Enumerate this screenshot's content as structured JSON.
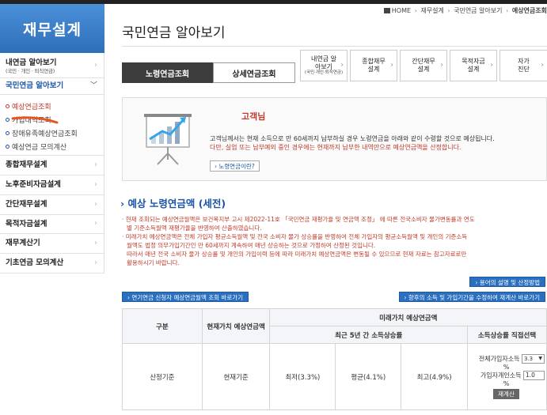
{
  "sidebar": {
    "title": "재무설계",
    "items": [
      {
        "label": "내연금 알아보기",
        "sub": "(국민 · 개인 · 퇴직연금)"
      },
      {
        "label": "국민연금 알아보기"
      },
      {
        "label": "종합재무설계"
      },
      {
        "label": "노후준비자금설계"
      },
      {
        "label": "간단재무설계"
      },
      {
        "label": "목적자금설계"
      },
      {
        "label": "재무계산기"
      },
      {
        "label": "기초연금 모의계산"
      }
    ],
    "subitems": [
      "예상연금조회",
      "가입내역조회",
      "장애유족예상연금조회",
      "예상연금 모의계산"
    ]
  },
  "breadcrumb": {
    "home": "HOME",
    "items": [
      "재무설계",
      "국민연금 알아보기"
    ],
    "current": "예상연금조회"
  },
  "page_title": "국민연금 알아보기",
  "tabs": {
    "main": [
      "노령연금조회",
      "상세연금조회"
    ],
    "secondary": [
      {
        "label": "내연금 알아보기",
        "sub": "(국민·개인·퇴직연금)"
      },
      {
        "label": "종합재무 설계"
      },
      {
        "label": "간단재무 설계"
      },
      {
        "label": "목적자금 설계"
      },
      {
        "label": "자가 진단"
      }
    ]
  },
  "card": {
    "name": "고객님",
    "line1": "고객님께서는 현재 소득으로 만 60세까지 납부하실 경우 노령연금을 아래와 같이 수령할 것으로 예상됩니다.",
    "line2": "다만, 실업 또는 납부예외 중인 경우에는 현재까지 납부한 내역만으로 예상연금액을 산정합니다.",
    "button": "› 노령연금이란?"
  },
  "section_title": "› 예상 노령연금액 (세전)",
  "notes": [
    "· 현재 조회되는 예상연금월액은 보건복지부 고시 제2022-11호 「국민연금 재평가율 및 연금액 조정」 에 따른 전국소비자 물가변동률과 연도",
    "별 기준소득월액 재평가율을 반영하여 산출하였습니다.",
    "· 미래가치 예상연금액은 전체 가입자 평균소득월액 및 전국 소비자 물가 상승률을 반영하여 전체 가입자의 평균소득월액 및 개인의 기준소득",
    "월액도 법정 의무가입기간인 만 60세까지 계속하여 매년 상승하는 것으로 가정하여 산정된 것입니다.",
    "따라서 매년 전국 소비자 물가 상승률 및 개인의 가입이력 등에 따라 미래가치 예상연금액은 변동될 수 있으므로 현재 자료는 참고자료로만",
    "활용하시기 바랍니다."
  ],
  "buttons": {
    "terms": "› 용어의 설명 및 산정방법",
    "apply": "› 연기연금 신청자 예상연금월액 조회 바로가기",
    "recalc_link": "› 향후의 소득 및 가입기간을 수정하여 재계산 바로가기"
  },
  "table": {
    "col_gubun": "구분",
    "col_current": "현재가치 예상연금액",
    "col_future": "미래가치 예상연금액",
    "col_recent": "최근 5년 간 소득상승률",
    "col_direct": "소득상승률 직접선택",
    "row_label": "산정기준",
    "row_current": "현재기준",
    "low": "최저(3.3%)",
    "avg": "평균(4.1%)",
    "high": "최고(4.9%)",
    "ctrl_all_label": "전체가입자소득",
    "ctrl_all_value": "3.3",
    "ctrl_pct": "%",
    "ctrl_self_label": "가입자개인소득",
    "ctrl_self_value": "1.0",
    "recalc_button": "재계산"
  }
}
